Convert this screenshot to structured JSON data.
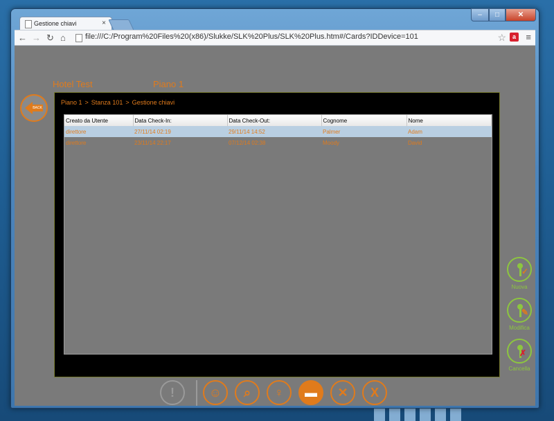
{
  "browser": {
    "tab_title": "Gestione chiavi",
    "tab_close": "×",
    "url": "file:///C:/Program%20Files%20(x86)/Slukke/SLK%20Plus/SLK%20Plus.htm#/Cards?IDDevice=101",
    "icons": [
      "back-arrow-icon",
      "forward-arrow-icon",
      "reload-icon",
      "home-icon",
      "star-icon",
      "extension-icon",
      "menu-icon"
    ]
  },
  "header": {
    "hotel": "Hotel Test",
    "floor": "Piano 1",
    "back_label": "BACK"
  },
  "breadcrumb": {
    "items": [
      "Piano 1",
      "Stanza 101",
      "Gestione chiavi"
    ],
    "separator": ">"
  },
  "table": {
    "columns": [
      "Creato da Utente",
      "Data Check-In:",
      "Data Check-Out:",
      "Cognome",
      "Nome"
    ],
    "rows": [
      [
        "direttore",
        "27/11/14 02:19",
        "29/11/14 14:52",
        "Palmer",
        "Adam"
      ],
      [
        "direttore",
        "23/11/14 22:17",
        "07/12/14 02:38",
        "Moody",
        "David"
      ]
    ]
  },
  "actions": {
    "new": "Nuova",
    "edit": "Modifica",
    "delete": "Cancella"
  },
  "colors": {
    "accent": "#e07b1c",
    "action_green": "#8dc63f",
    "delete_red": "#d8202e"
  }
}
